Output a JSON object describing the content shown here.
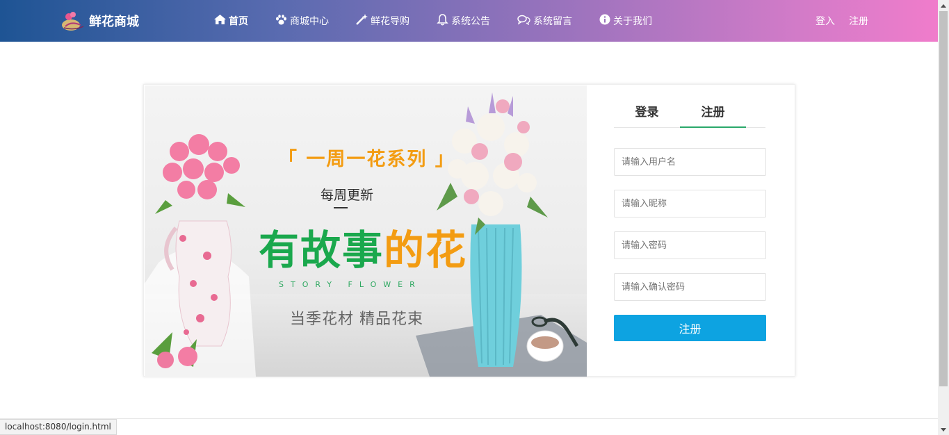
{
  "header": {
    "brand": "鲜花商城",
    "nav": [
      {
        "label": "首页",
        "icon": "home-icon"
      },
      {
        "label": "商城中心",
        "icon": "paw-icon"
      },
      {
        "label": "鲜花导购",
        "icon": "magic-wand-icon"
      },
      {
        "label": "系统公告",
        "icon": "bell-icon"
      },
      {
        "label": "系统留言",
        "icon": "comments-icon"
      },
      {
        "label": "关于我们",
        "icon": "info-circle-icon"
      }
    ],
    "auth": {
      "login": "登入",
      "register": "注册"
    }
  },
  "banner": {
    "series": "「 一周一花系列 」",
    "weekly": "每周更新",
    "main_green": "有故事",
    "main_orange": "的花",
    "english": "STORY FLOWER",
    "sub": "当季花材  精品花束"
  },
  "form": {
    "tabs": [
      "登录",
      "注册"
    ],
    "active_tab": "注册",
    "username_placeholder": "请输入用户名",
    "nickname_placeholder": "请输入昵称",
    "password_placeholder": "请输入密码",
    "confirm_placeholder": "请输入确认密码",
    "submit": "注册"
  },
  "status_url": "localhost:8080/login.html",
  "colors": {
    "accent": "#0da3e1",
    "tab_underline": "#2aa86a"
  }
}
